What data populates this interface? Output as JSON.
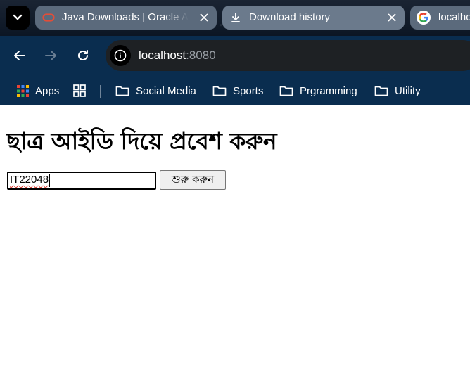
{
  "browser": {
    "tabs": [
      {
        "title": "Java Downloads | Oracle Al",
        "favicon": "oracle-icon",
        "active": false
      },
      {
        "title": "Download history",
        "favicon": "download-icon",
        "active": true
      },
      {
        "title": "localho",
        "favicon": "google-icon",
        "active": false
      }
    ],
    "url": {
      "host": "localhost",
      "port": ":8080"
    },
    "bookmarks": [
      {
        "label": "Apps",
        "icon": "apps-icon"
      },
      {
        "label": "",
        "icon": "grid-icon"
      },
      {
        "label": "Social Media",
        "icon": "folder-icon"
      },
      {
        "label": "Sports",
        "icon": "folder-icon"
      },
      {
        "label": "Prgramming",
        "icon": "folder-icon"
      },
      {
        "label": "Utility",
        "icon": "folder-icon"
      }
    ],
    "colors": {
      "tab_strip": "#1a2433",
      "toolbar": "#0a2d4f",
      "tab": "#5b6a7c",
      "omnibox": "#1e2124"
    }
  },
  "page": {
    "heading": "ছাত্র আইডি দিয়ে প্রবেশ করুন",
    "student_id_value": "IT22048",
    "start_button_label": "শুরু করুন"
  }
}
